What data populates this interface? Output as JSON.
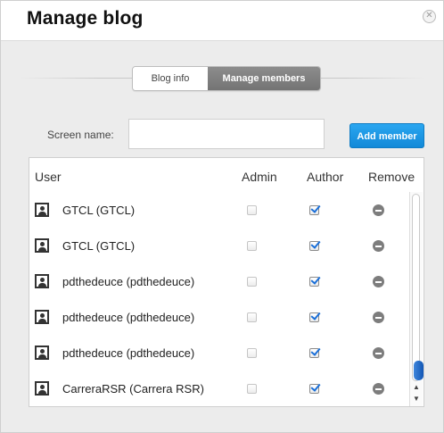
{
  "dialog": {
    "title": "Manage blog",
    "close_icon": "close-icon"
  },
  "tabs": [
    {
      "label": "Blog info",
      "active": false
    },
    {
      "label": "Manage members",
      "active": true
    }
  ],
  "screen_name": {
    "label": "Screen name:",
    "value": "",
    "placeholder": ""
  },
  "add_member_label": "Add member",
  "table": {
    "columns": [
      "User",
      "Admin",
      "Author",
      "Remove"
    ],
    "rows": [
      {
        "user": "GTCL (GTCL)",
        "admin": false,
        "author": true
      },
      {
        "user": "GTCL (GTCL)",
        "admin": false,
        "author": true
      },
      {
        "user": "pdthedeuce (pdthedeuce)",
        "admin": false,
        "author": true
      },
      {
        "user": "pdthedeuce (pdthedeuce)",
        "admin": false,
        "author": true
      },
      {
        "user": "pdthedeuce (pdthedeuce)",
        "admin": false,
        "author": true
      },
      {
        "user": "CarreraRSR (Carrera RSR)",
        "admin": false,
        "author": true
      }
    ]
  },
  "colors": {
    "accent": "#1a8fe0",
    "active_tab": "#7f7f7f",
    "background": "#ececec"
  },
  "icons": {
    "avatar": "user-avatar-icon",
    "remove": "remove-minus-icon"
  }
}
